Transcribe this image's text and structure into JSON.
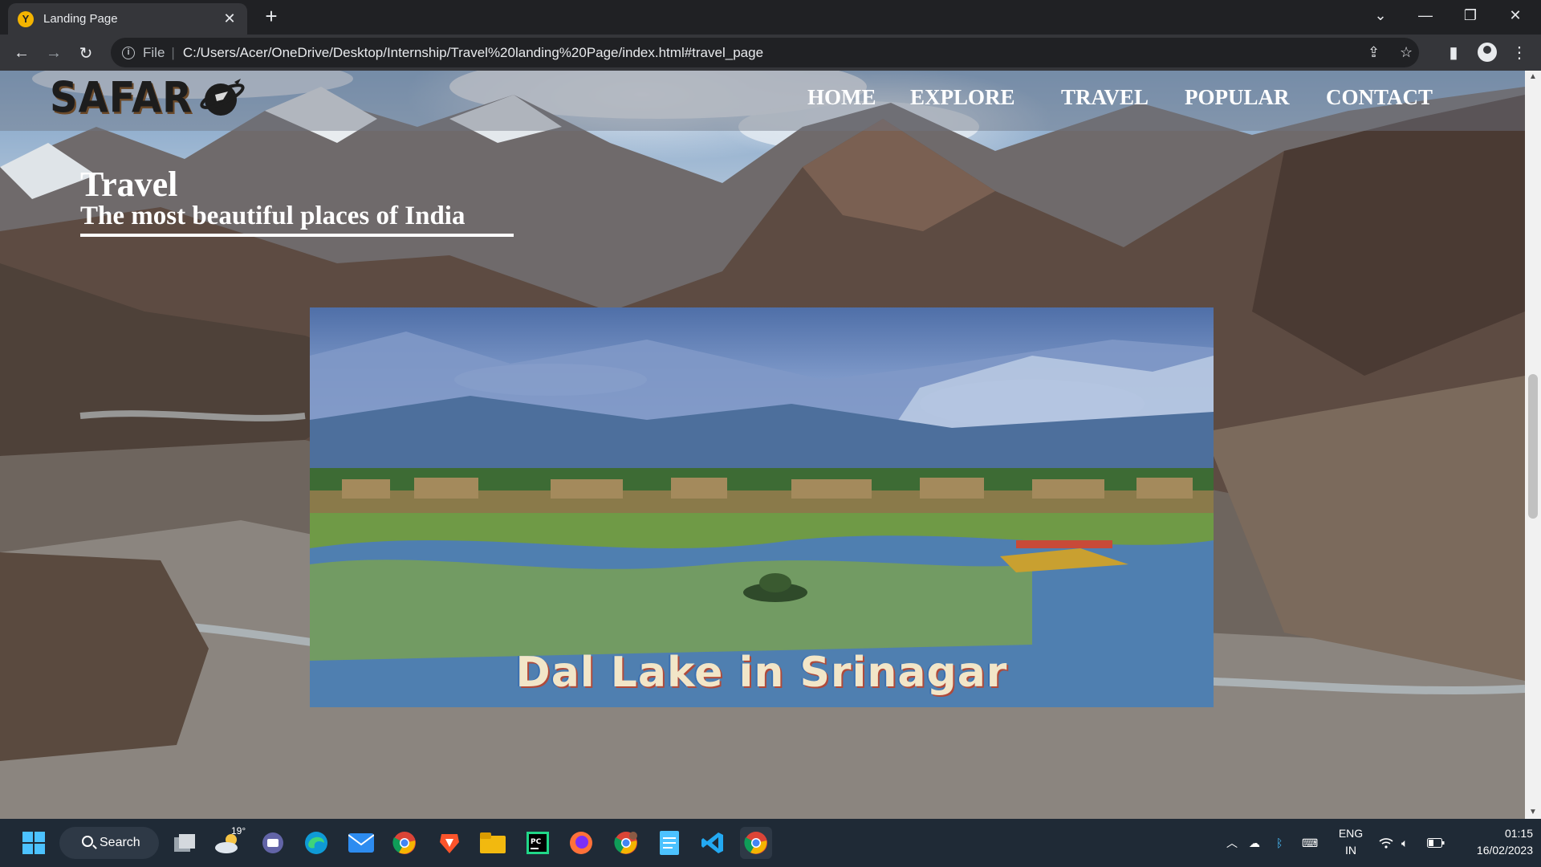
{
  "browser": {
    "tab_title": "Landing Page",
    "favicon_letter": "Y",
    "url_scheme": "File",
    "url": "C:/Users/Acer/OneDrive/Desktop/Internship/Travel%20landing%20Page/index.html#travel_page",
    "icons": [
      "back-icon",
      "forward-icon",
      "reload-icon",
      "info-icon",
      "share-icon",
      "star-icon",
      "side-panel-icon",
      "profile-icon",
      "menu-icon",
      "tab-search-icon",
      "minimize-icon",
      "restore-icon",
      "close-icon"
    ]
  },
  "site": {
    "logo": "SAFAR",
    "nav": [
      "HOME",
      "EXPLORE",
      "TRAVEL",
      "POPULAR",
      "CONTACT"
    ],
    "hero_title": "Travel",
    "hero_subtitle": "The most beautiful places of India",
    "slide_caption": "Dal Lake in Srinagar"
  },
  "taskbar": {
    "search_label": "Search",
    "weather_temp": "19°",
    "apps": [
      "start-icon",
      "search-icon",
      "task-view-icon",
      "weather-icon",
      "teams-icon",
      "edge-icon",
      "mail-icon",
      "chrome-icon",
      "brave-icon",
      "file-explorer-icon",
      "pycharm-icon",
      "firefox-icon",
      "chrome-profile-icon",
      "notepad-icon",
      "vscode-icon",
      "chrome-active-icon"
    ],
    "tray_icons": [
      "chevron-up-icon",
      "onedrive-icon",
      "bluetooth-icon",
      "keyboard-icon",
      "wifi-icon",
      "volume-icon",
      "battery-icon"
    ],
    "lang_top": "ENG",
    "lang_bottom": "IN",
    "time": "01:15",
    "date": "16/02/2023"
  },
  "colors": {
    "chrome_dark": "#202124",
    "chrome_toolbar": "#35363a",
    "taskbar": "#1f2a36",
    "nav_text": "#ffffff"
  }
}
